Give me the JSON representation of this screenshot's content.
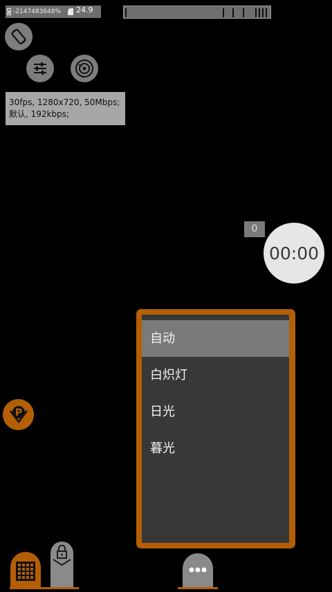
{
  "status": {
    "battery_text": "-2147483648%",
    "temperature": "24.9"
  },
  "info": {
    "line1": "30fps, 1280x720, 50Mbps;",
    "line2": "默认, 192kbps;"
  },
  "recording": {
    "counter": "0",
    "timer": "00:00"
  },
  "white_balance_menu": {
    "items": [
      {
        "label": "自动",
        "selected": true
      },
      {
        "label": "白炽灯",
        "selected": false
      },
      {
        "label": "日光",
        "selected": false
      },
      {
        "label": "暮光",
        "selected": false
      }
    ]
  },
  "icons": {
    "rotate": "screen-rotation-icon",
    "settings": "sliders-icon",
    "lens": "lens-icon",
    "park": "park-icon",
    "grid": "grid-icon",
    "lock": "lock-icon",
    "more": "more-icon"
  },
  "colors": {
    "accent": "#b45f06",
    "button_gray": "#7d7d7d",
    "menu_bg": "#383838",
    "menu_selected": "#7a7a7a"
  }
}
